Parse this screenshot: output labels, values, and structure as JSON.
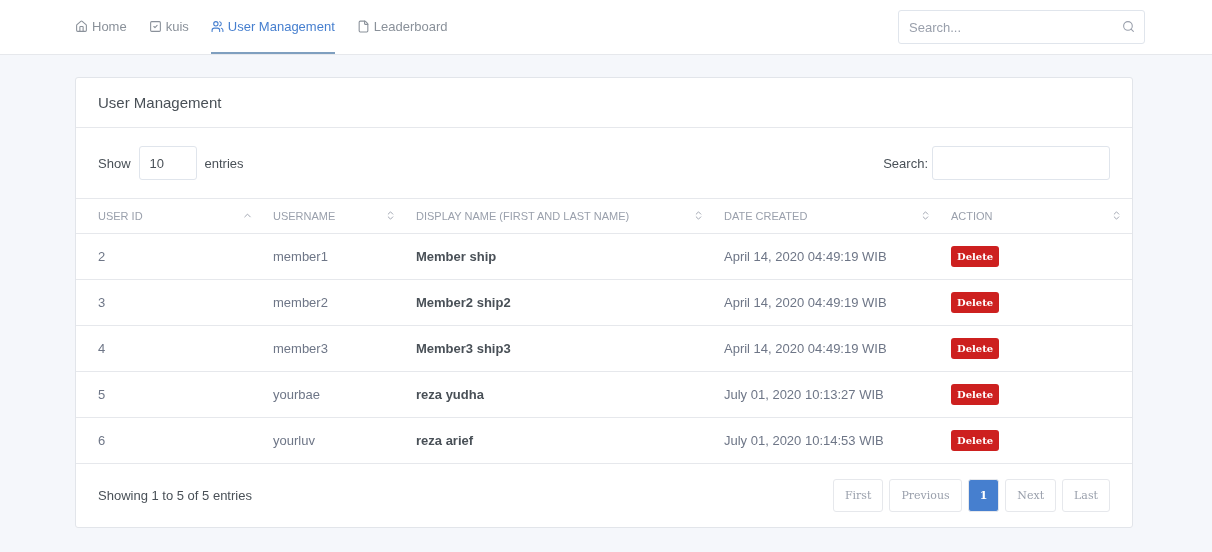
{
  "nav": {
    "items": [
      {
        "label": "Home",
        "selected": false
      },
      {
        "label": "kuis",
        "selected": false
      },
      {
        "label": "User Management",
        "selected": true
      },
      {
        "label": "Leaderboard",
        "selected": false
      }
    ],
    "search": {
      "placeholder": "Search..."
    }
  },
  "card": {
    "title": "User Management",
    "length": {
      "prefix": "Show",
      "value": "10",
      "suffix": "entries"
    },
    "filter": {
      "label": "Search:"
    },
    "table": {
      "columns": [
        {
          "label": "USER ID",
          "sorted": true
        },
        {
          "label": "USERNAME",
          "sorted": false
        },
        {
          "label": "DISPLAY NAME (FIRST AND LAST NAME)",
          "sorted": false
        },
        {
          "label": "DATE CREATED",
          "sorted": false
        },
        {
          "label": "ACTION",
          "sorted": false
        }
      ],
      "rows": [
        {
          "id": "2",
          "username": "member1",
          "display_name": "Member ship",
          "date": "April 14, 2020 04:49:19 WIB",
          "action": "Delete"
        },
        {
          "id": "3",
          "username": "member2",
          "display_name": "Member2 ship2",
          "date": "April 14, 2020 04:49:19 WIB",
          "action": "Delete"
        },
        {
          "id": "4",
          "username": "member3",
          "display_name": "Member3 ship3",
          "date": "April 14, 2020 04:49:19 WIB",
          "action": "Delete"
        },
        {
          "id": "5",
          "username": "yourbae",
          "display_name": "reza yudha",
          "date": "July 01, 2020 10:13:27 WIB",
          "action": "Delete"
        },
        {
          "id": "6",
          "username": "yourluv",
          "display_name": "reza arief",
          "date": "July 01, 2020 10:14:53 WIB",
          "action": "Delete"
        }
      ]
    },
    "info": "Showing 1 to 5 of 5 entries",
    "pagination": [
      {
        "label": "First",
        "selected": false
      },
      {
        "label": "Previous",
        "selected": false
      },
      {
        "label": "1",
        "selected": true
      },
      {
        "label": "Next",
        "selected": false
      },
      {
        "label": "Last",
        "selected": false
      }
    ]
  }
}
